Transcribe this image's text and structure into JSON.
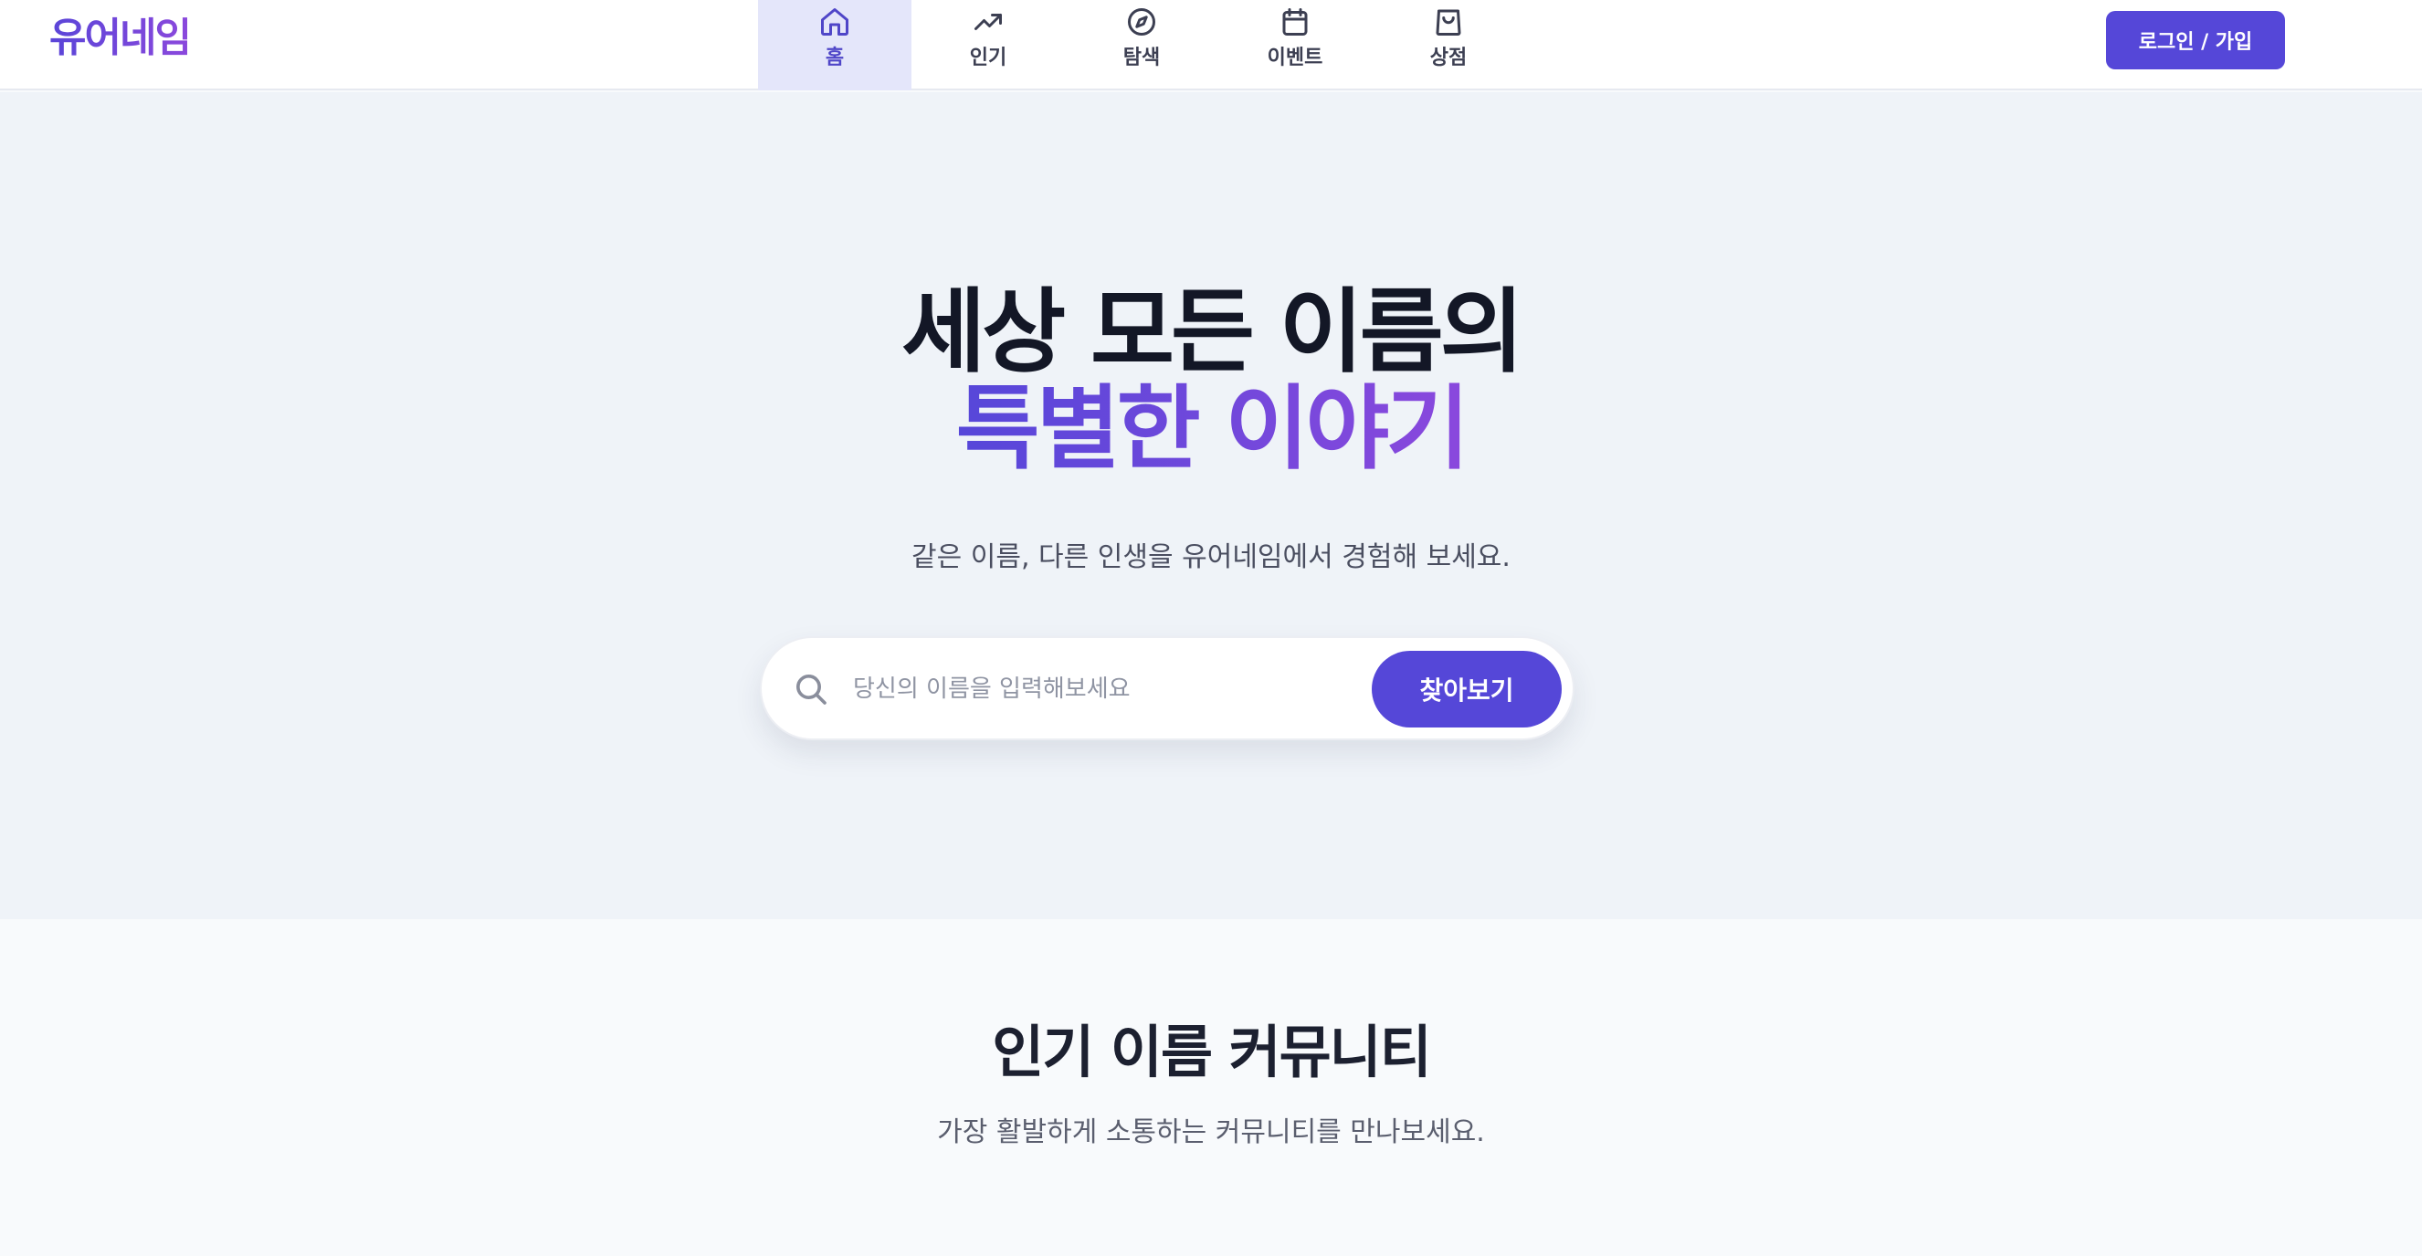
{
  "header": {
    "logo": "유어네임",
    "nav": [
      {
        "label": "홈",
        "icon": "home-icon",
        "active": true
      },
      {
        "label": "인기",
        "icon": "trending-icon",
        "active": false
      },
      {
        "label": "탐색",
        "icon": "compass-icon",
        "active": false
      },
      {
        "label": "이벤트",
        "icon": "calendar-icon",
        "active": false
      },
      {
        "label": "상점",
        "icon": "shopping-bag-icon",
        "active": false
      }
    ],
    "login_label": "로그인 / 가입"
  },
  "hero": {
    "title_line1": "세상 모든 이름의",
    "title_line2": "특별한 이야기",
    "subtitle": "같은 이름, 다른 인생을 유어네임에서 경험해 보세요.",
    "search": {
      "placeholder": "당신의 이름을 입력해보세요",
      "button_label": "찾아보기",
      "icon": "search-icon"
    }
  },
  "community": {
    "title": "인기 이름 커뮤니티",
    "subtitle": "가장 활발하게 소통하는 커뮤니티를 만나보세요."
  },
  "colors": {
    "accent": "#5547d8",
    "gradient_end": "#8a48dd",
    "nav_active_bg": "#e4e6fa",
    "hero_bg": "#eff3f8"
  }
}
